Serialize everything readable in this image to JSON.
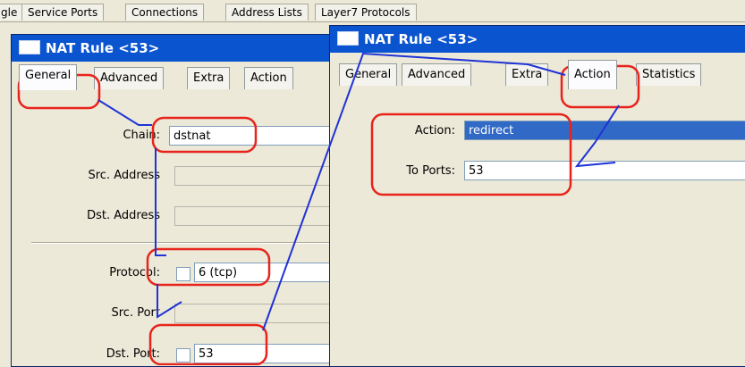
{
  "background_tabs": [
    "gle",
    "Service Ports",
    "Connections",
    "Address Lists",
    "Layer7 Protocols"
  ],
  "left_window": {
    "title": "NAT Rule <53>",
    "tabs": [
      "General",
      "Advanced",
      "Extra",
      "Action"
    ],
    "active_tab": "General",
    "fields": {
      "chain_label": "Chain:",
      "chain_value": "dstnat",
      "src_address_label": "Src. Address",
      "dst_address_label": "Dst. Address",
      "protocol_label": "Protocol:",
      "protocol_value": "6 (tcp)",
      "src_port_label": "Src. Port",
      "dst_port_label": "Dst. Port:",
      "dst_port_value": "53"
    }
  },
  "right_window": {
    "title": "NAT Rule <53>",
    "tabs": [
      "General",
      "Advanced",
      "Extra",
      "Action",
      "Statistics"
    ],
    "active_tab": "Action",
    "fields": {
      "action_label": "Action:",
      "action_value": "redirect",
      "to_ports_label": "To Ports:",
      "to_ports_value": "53"
    }
  },
  "annotation_colors": {
    "highlight_red": "#e8231c",
    "arrow_blue": "#1f33d6",
    "title_blue": "#0a54cf"
  }
}
